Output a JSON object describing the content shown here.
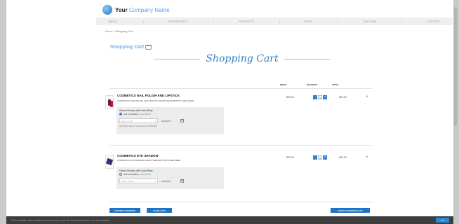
{
  "brand": {
    "name_bold": "Your",
    "name_light": "Company Name"
  },
  "nav": {
    "items": [
      "ABOUT",
      "OPPORTUNITY",
      "PRODUCTS",
      "SHOP",
      "JOIN NOW",
      "CONTACT"
    ],
    "separator": "|"
  },
  "breadcrumb": "Home > Shopping Cart",
  "section_label": "Shopping Cart",
  "page_title": "Shopping Cart",
  "columns": {
    "price": "PRICE",
    "quantity": "QUANTITY",
    "total": "TOTAL"
  },
  "products": [
    {
      "name": "COSMETICS NAIL POLISH AND LIPSTICK",
      "description": "COSMETICS NAIL POLISH AND LIPSTICK SHORT DESCRIPTION GOES HERE",
      "autoship_title": "Save Money with AutoShip",
      "autoship_option": "Add to AutoShip",
      "autoship_savings": "Save $2.00",
      "autoship_selected": true,
      "frequency_placeholder": "Every month",
      "date": "6/18/2019",
      "autoship_note": "AutoShip: Every week starting 6/18/2019",
      "price": "$20.00",
      "quantity": "1",
      "total": "$20.00",
      "remove": "×"
    },
    {
      "name": "COSMETICS EYE SHADOW",
      "description": "COSMETICS EYE SHADOW SHORT DESCRIPTION GOES HERE",
      "autoship_title": "Save Money with AutoShip",
      "autoship_option": "Add to AutoShip",
      "autoship_savings": "Save $2.00",
      "autoship_selected": false,
      "frequency_placeholder": "Select Option",
      "date": "6/18/2019",
      "price": "$20.00",
      "quantity": "1",
      "total": "$20.00",
      "remove": "×"
    }
  ],
  "qty_minus": "-",
  "qty_plus": "+",
  "buttons": {
    "continue": "CONTINUE SHOPPING",
    "clear": "CLEAR CART",
    "update": "UPDATE SHOPPING CART"
  },
  "cookie": {
    "text": "This website uses cookies to ensure you get the best experience on our website.",
    "accept": "OK"
  },
  "colors": {
    "accent": "#1f74c4",
    "title": "#2f7fc8",
    "background": "#c9c9c9"
  }
}
